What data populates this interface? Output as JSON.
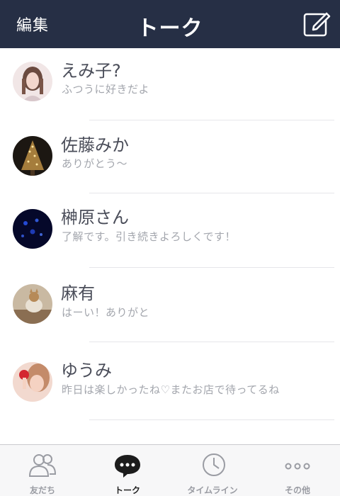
{
  "header": {
    "edit_label": "編集",
    "title": "トーク",
    "compose_icon": "compose-icon"
  },
  "chats": [
    {
      "name": "えみ子?",
      "preview": "ふつうに好きだよ",
      "avatar": "woman-portrait"
    },
    {
      "name": "佐藤みか",
      "preview": "ありがとう〜",
      "avatar": "christmas-tree"
    },
    {
      "name": "榊原さん",
      "preview": "了解です。引き続きよろしくです！",
      "avatar": "jellyfish-aquarium"
    },
    {
      "name": "麻有",
      "preview": "はーい！ありがと",
      "avatar": "cat-photo"
    },
    {
      "name": "ゆうみ",
      "preview": "昨日は楽しかったね♡またお店で待ってるね",
      "avatar": "woman-strawberry"
    }
  ],
  "tabbar": {
    "items": [
      {
        "label": "友だち",
        "icon": "friends-icon",
        "active": false
      },
      {
        "label": "トーク",
        "icon": "chat-bubble-icon",
        "active": true
      },
      {
        "label": "タイムライン",
        "icon": "clock-icon",
        "active": false
      },
      {
        "label": "その他",
        "icon": "more-dots-icon",
        "active": false
      }
    ]
  },
  "colors": {
    "header_bg": "#262f45",
    "name_text": "#4a4d59",
    "preview_text": "#a3a6ad",
    "tabbar_bg": "#f7f7f8"
  }
}
